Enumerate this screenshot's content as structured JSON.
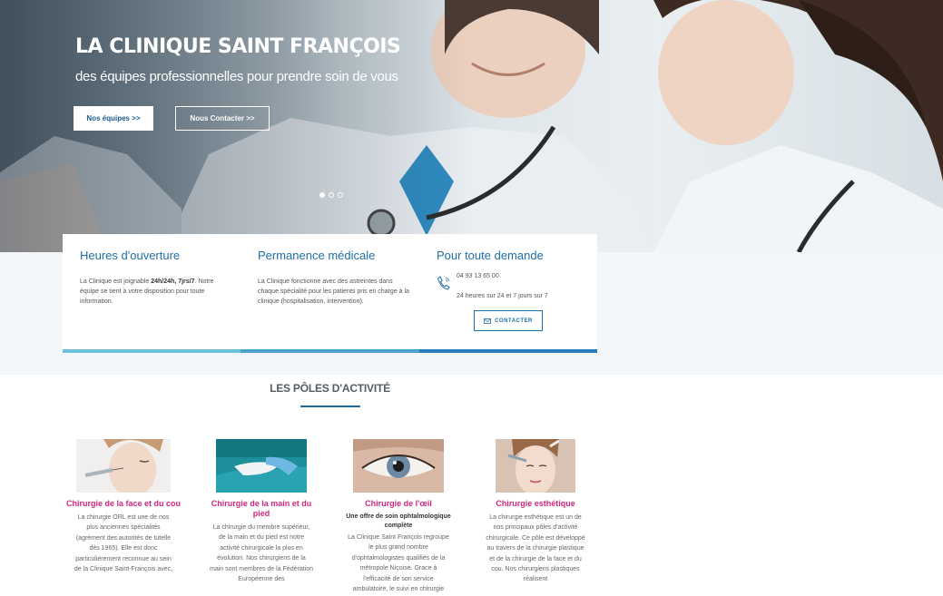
{
  "hero": {
    "title": "LA CLINIQUE SAINT FRANÇOIS",
    "subtitle": "des équipes professionnelles  pour prendre soin de vous",
    "btn_primary": "Nos équipes >>",
    "btn_secondary": "Nous Contacter >>",
    "slides_total": 3,
    "slide_active": 1
  },
  "info": {
    "col1": {
      "title": "Heures d'ouverture",
      "text_before": "La Clinique est joignable ",
      "text_bold": "24h/24h, 7jrs/7",
      "text_after": ". Notre équipe se tient à votre disposition pour toute information."
    },
    "col2": {
      "title": "Permanence médicale",
      "text": "La Clinique fonctionne avec des astreintes dans chaque spécialité pour les patients pris en charge à la clinique (hospitalisation, intervention)."
    },
    "col3": {
      "title": "Pour toute demande",
      "phone": "04 93 13 65 00",
      "hours": "24 heures sur 24 et 7 jours sur 7",
      "button": "CONTACTER"
    },
    "bar_colors": [
      "#6fc3d8",
      "#4ba3cc",
      "#2a7dba"
    ]
  },
  "poles": {
    "title": "LES PÔLES D'ACTIVITÉ",
    "items": [
      {
        "title": "Chirurgie de la face et du cou",
        "lead": "",
        "text": "La chirurgie ORL est une de nos plus anciennes spécialités (agrément des autorités de tutelle dès 1965). Elle est donc particulièrement reconnue au sein de la Clinique Saint-François avec,"
      },
      {
        "title": "Chirurgie de la main et du pied",
        "lead": "",
        "text": "La chirurgie du membre supérieur, de la main et du pied est notre activité chirurgicale la plus en évolution. Nos chirurgiens de la main sont membres de la Fédération Européenne des"
      },
      {
        "title": "Chirurgie de l'œil",
        "lead": "Une offre de soin ophtalmologique complète",
        "text": "La Clinique Saint François regroupe le plus grand nombre d'ophtalmologistes qualifiés de la métropole Niçoise. Grace à l'efficacité de son service ambulatoire, le suivi en chirurgie"
      },
      {
        "title": "Chirurgie esthétique",
        "lead": "",
        "text": "La chirurgie esthétique est un de nos principaux pôles d'activité chirurgicale. Ce pôle est développé au travers de la chirurgie plastique et de la chirurgie de la face et du cou. Nos chirurgiens plastiques réalisent"
      }
    ]
  },
  "colors": {
    "accent": "#1f6ea7",
    "pink": "#d4287c"
  }
}
